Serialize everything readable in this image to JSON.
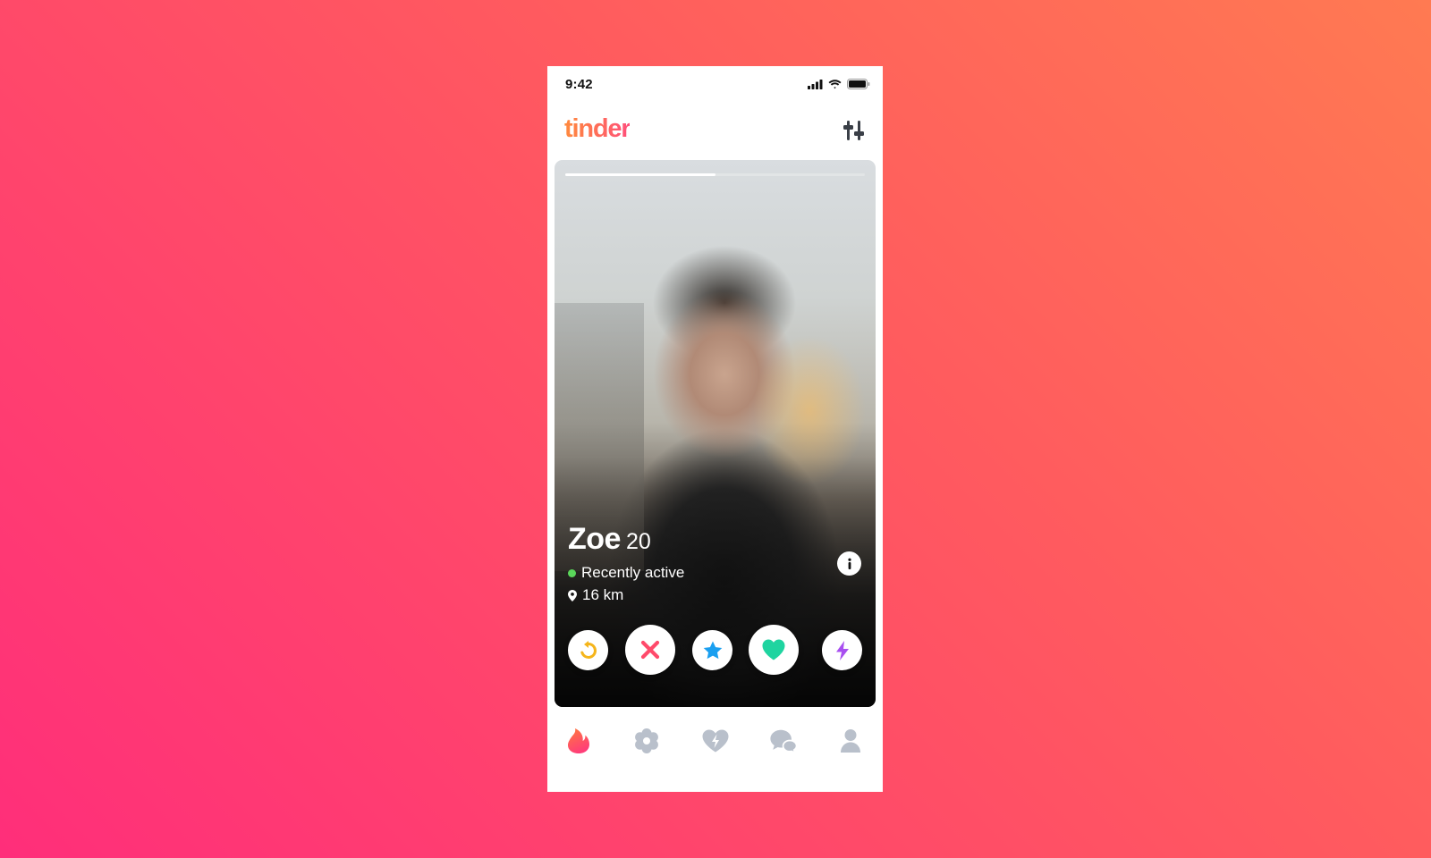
{
  "status_bar": {
    "time": "9:42"
  },
  "header": {
    "logo_text": "tinder"
  },
  "card": {
    "photo_count": 2,
    "photo_index": 1,
    "profile": {
      "name": "Zoe",
      "age": "20",
      "status": "Recently active",
      "distance": "16 km"
    }
  },
  "actions": [
    {
      "icon": "rewind-icon",
      "color": "#f5b51b"
    },
    {
      "icon": "nope-icon",
      "color": "#ff4a6b"
    },
    {
      "icon": "super-like-icon",
      "color": "#1a9ff0"
    },
    {
      "icon": "like-icon",
      "color": "#1fd4a0"
    },
    {
      "icon": "boost-icon",
      "color": "#a84ff0"
    }
  ],
  "bottom_nav": [
    {
      "icon": "flame-icon",
      "active": true
    },
    {
      "icon": "explore-icon",
      "active": false
    },
    {
      "icon": "likes-icon",
      "active": false
    },
    {
      "icon": "chat-icon",
      "active": false
    },
    {
      "icon": "profile-icon",
      "active": false
    }
  ],
  "colors": {
    "brand_gradient_start": "#ff8a3d",
    "brand_gradient_end": "#ff4f7a",
    "nav_inactive": "#b9c0cb",
    "active_status": "#5ad65a"
  }
}
